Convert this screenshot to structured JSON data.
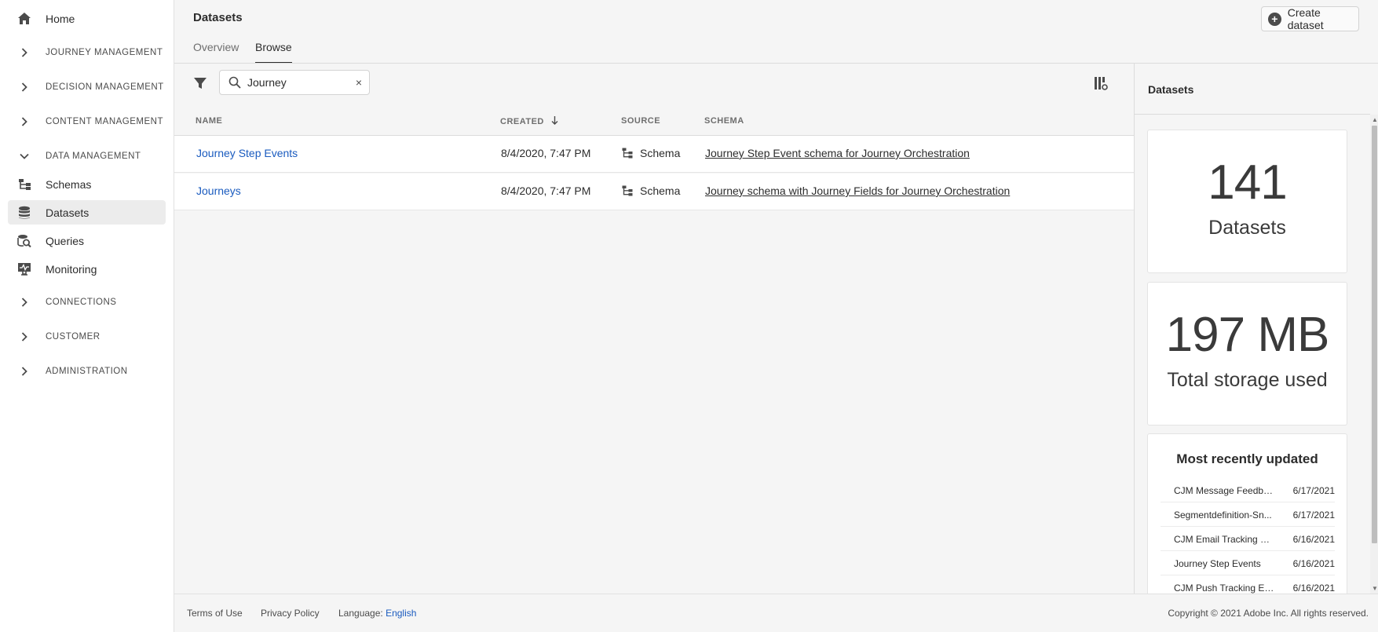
{
  "sidebar": {
    "home": "Home",
    "sections": {
      "journey": "JOURNEY MANAGEMENT",
      "decision": "DECISION MANAGEMENT",
      "content": "CONTENT MANAGEMENT",
      "data": "DATA MANAGEMENT",
      "connections": "CONNECTIONS",
      "customer": "CUSTOMER",
      "administration": "ADMINISTRATION"
    },
    "items": {
      "schemas": "Schemas",
      "datasets": "Datasets",
      "queries": "Queries",
      "monitoring": "Monitoring"
    },
    "active_item": "Datasets"
  },
  "header": {
    "title": "Datasets",
    "create_button": "Create dataset",
    "tabs": [
      "Overview",
      "Browse"
    ],
    "selected_tab": "Browse"
  },
  "toolbar": {
    "search_value": "Journey",
    "clear_label": "×"
  },
  "table": {
    "columns": {
      "name": "NAME",
      "created": "CREATED",
      "source": "SOURCE",
      "schema": "SCHEMA"
    },
    "sort_column": "CREATED",
    "sort_direction": "descending",
    "rows": [
      {
        "name": "Journey Step Events",
        "created": "8/4/2020, 7:47 PM",
        "source": "Schema",
        "schema": "Journey Step Event schema for Journey Orchestration"
      },
      {
        "name": "Journeys",
        "created": "8/4/2020, 7:47 PM",
        "source": "Schema",
        "schema": "Journey schema with Journey Fields for Journey Orchestration"
      }
    ]
  },
  "panel": {
    "title": "Datasets",
    "count_value": "141",
    "count_label": "Datasets",
    "storage_value": "197 MB",
    "storage_label": "Total storage used",
    "recent_title": "Most recently updated",
    "recent": [
      {
        "name": "CJM Message Feedbac...",
        "date": "6/17/2021"
      },
      {
        "name": "Segmentdefinition-Sn...",
        "date": "6/17/2021"
      },
      {
        "name": "CJM Email Tracking Ex...",
        "date": "6/16/2021"
      },
      {
        "name": "Journey Step Events",
        "date": "6/16/2021"
      },
      {
        "name": "CJM Push Tracking Ex...",
        "date": "6/16/2021"
      }
    ]
  },
  "footer": {
    "terms": "Terms of Use",
    "privacy": "Privacy Policy",
    "language_label": "Language:",
    "language_value": "English",
    "copyright": "Copyright ©  2021 Adobe Inc.  All rights reserved."
  },
  "colors": {
    "link": "#1a5bbf",
    "sidebar_active": "#ececec",
    "row_background": "#ffffff",
    "page_background": "#f5f5f5"
  }
}
